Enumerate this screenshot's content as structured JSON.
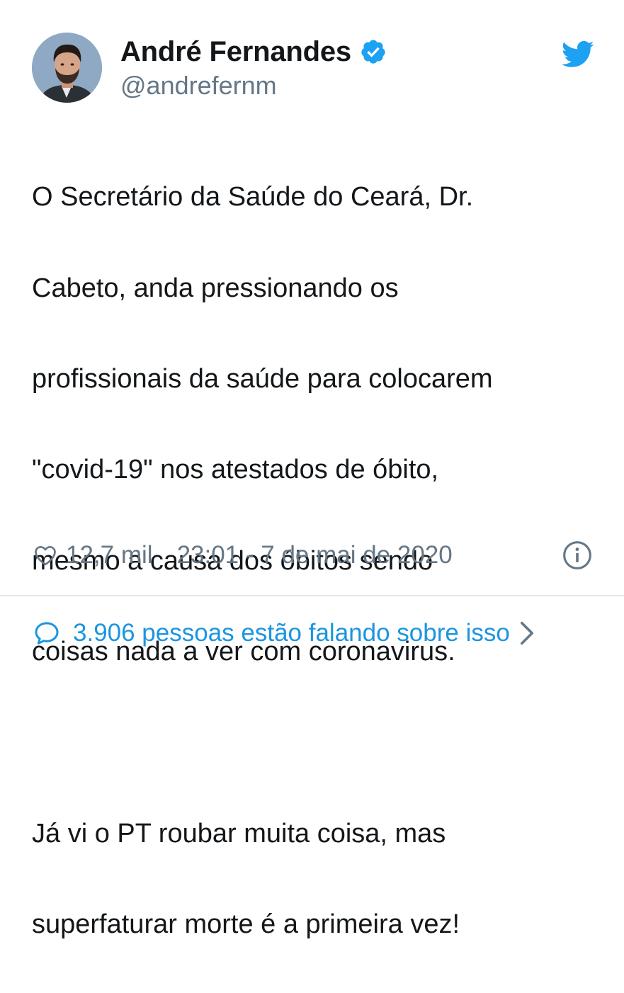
{
  "author": {
    "display_name": "André Fernandes",
    "handle": "@andrefernm",
    "verified": true
  },
  "tweet": {
    "lines": [
      "O Secretário da Saúde do Ceará, Dr.",
      "Cabeto, anda pressionando os",
      "profissionais da saúde para colocarem",
      "\"covid-19\" nos atestados de óbito,",
      "mesmo a causa dos óbitos sendo",
      "coisas nada a ver com coronavirus.",
      "",
      "Já vi o PT roubar muita coisa, mas",
      "superfaturar morte é a primeira vez!"
    ]
  },
  "meta": {
    "like_count": "12,7 mil",
    "timestamp": "23:01 - 7 de mai de 2020"
  },
  "conversation": {
    "label": "3.906 pessoas estão falando sobre isso"
  },
  "icons": {
    "brand": "twitter-bird-icon",
    "verified": "verified-badge-icon",
    "like": "heart-icon",
    "info": "info-icon",
    "conversation": "chat-bubble-icon",
    "chevron": "chevron-right-icon"
  },
  "colors": {
    "brand_blue": "#1da1f2",
    "link_blue": "#1b95e0",
    "secondary_text": "#657786",
    "primary_text": "#14171a",
    "divider": "#e1e8ed"
  }
}
